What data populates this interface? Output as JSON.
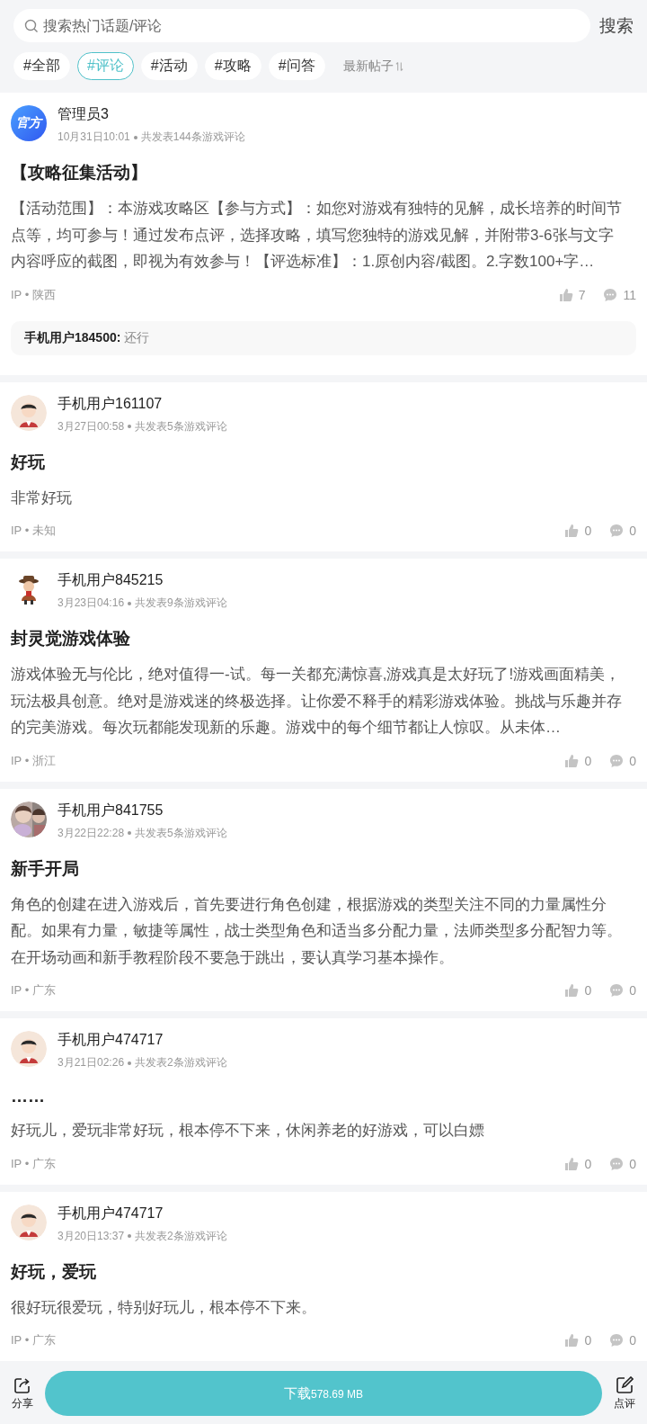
{
  "search": {
    "placeholder": "搜索热门话题/评论",
    "button": "搜索"
  },
  "tabs": [
    {
      "label": "#全部",
      "selected": false
    },
    {
      "label": "#评论",
      "selected": true
    },
    {
      "label": "#活动",
      "selected": false
    },
    {
      "label": "#攻略",
      "selected": false
    },
    {
      "label": "#问答",
      "selected": false
    }
  ],
  "sort": {
    "label": "最新帖子"
  },
  "posts": [
    {
      "avatar": {
        "kind": "official",
        "text": "官方"
      },
      "author": "管理员3",
      "time": "10月31日10:01",
      "meta": "共发表144条游戏评论",
      "title": "【攻略征集活动】",
      "body": "【活动范围】：本游戏攻略区【参与方式】：如您对游戏有独特的见解，成长培养的时间节点等，均可参与！通过发布点评，选择攻略，填写您独特的游戏见解，并附带3-6张与文字内容呼应的截图，即视为有效参与！【评选标准】：1.原创内容/截图。2.字数100+字…",
      "ip": "IP • 陕西",
      "likes": "7",
      "comments": "11",
      "replies": [
        "**手机用户184500:** 还行"
      ]
    },
    {
      "avatar": {
        "kind": "cartoon"
      },
      "author": "手机用户161107",
      "time": "3月27日00:58",
      "meta": "共发表5条游戏评论",
      "title": "好玩",
      "body": "非常好玩",
      "ip": "IP • 未知",
      "likes": "0",
      "comments": "0"
    },
    {
      "avatar": {
        "kind": "character"
      },
      "author": "手机用户845215",
      "time": "3月23日04:16",
      "meta": "共发表9条游戏评论",
      "title": "封灵觉游戏体验",
      "body": "游戏体验无与伦比，绝对值得一-试。每一关都充满惊喜,游戏真是太好玩了!游戏画面精美，玩法极具创意。绝对是游戏迷的终极选择。让你爱不释手的精彩游戏体验。挑战与乐趣并存的完美游戏。每次玩都能发现新的乐趣。游戏中的每个细节都让人惊叹。从未体…",
      "ip": "IP • 浙江",
      "likes": "0",
      "comments": "0"
    },
    {
      "author": "手机用户841755",
      "time": "3月22日22:28",
      "meta": "共发表5条游戏评论",
      "title": "新手开局",
      "body": "角色的创建在进入游戏后，首先要进行角色创建，根据游戏的类型关注不同的力量属性分配。如果有力量，敏捷等属性，战士类型角色和适当多分配力量，法师类型多分配智力等。在开场动画和新手教程阶段不要急于跳出，要认真学习基本操作。",
      "ip": "IP • 广东",
      "likes": "0",
      "comments": "0"
    },
    {
      "avatar": {
        "kind": "cartoon"
      },
      "author": "手机用户474717",
      "time": "3月21日02:26",
      "meta": "共发表2条游戏评论",
      "title": "……",
      "body": "好玩儿，爱玩非常好玩，根本停不下来，休闲养老的好游戏，可以白嫖",
      "ip": "IP • 广东",
      "likes": "0",
      "comments": "0"
    },
    {
      "avatar": {
        "kind": "cartoon"
      },
      "author": "手机用户474717",
      "time": "3月20日13:37",
      "meta": "共发表2条游戏评论",
      "title": "好玩，爱玩",
      "body": "很好玩很爱玩，特别好玩儿，根本停不下来。",
      "ip": "IP • 广东",
      "likes": "0",
      "comments": "0"
    }
  ],
  "bottom_bar": {
    "share": "分享",
    "download": "下载",
    "size": "578.69 MB",
    "review": "点评"
  }
}
